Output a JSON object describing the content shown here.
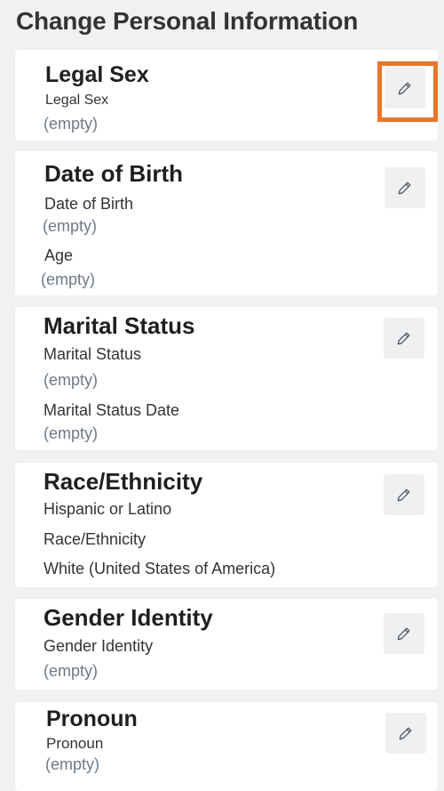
{
  "page": {
    "title": "Change Personal Information"
  },
  "highlight_color": "#e8762b",
  "sections": {
    "legal_sex": {
      "heading": "Legal Sex",
      "fields": [
        {
          "label": "Legal Sex",
          "value": "(empty)"
        }
      ],
      "edit_icon": "pencil-icon"
    },
    "date_of_birth": {
      "heading": "Date of Birth",
      "fields": [
        {
          "label": "Date of Birth",
          "value": "(empty)"
        },
        {
          "label": "Age",
          "value": "(empty)"
        }
      ],
      "edit_icon": "pencil-icon"
    },
    "marital_status": {
      "heading": "Marital Status",
      "fields": [
        {
          "label": "Marital Status",
          "value": "(empty)"
        },
        {
          "label": "Marital Status Date",
          "value": "(empty)"
        }
      ],
      "edit_icon": "pencil-icon"
    },
    "race_ethnicity": {
      "heading": "Race/Ethnicity",
      "fields": [
        {
          "label": "Hispanic or Latino"
        },
        {
          "label": "Race/Ethnicity",
          "value": "White (United States of America)"
        }
      ],
      "edit_icon": "pencil-icon"
    },
    "gender_identity": {
      "heading": "Gender Identity",
      "fields": [
        {
          "label": "Gender Identity",
          "value": "(empty)"
        }
      ],
      "edit_icon": "pencil-icon"
    },
    "pronoun": {
      "heading": "Pronoun",
      "fields": [
        {
          "label": "Pronoun",
          "value": "(empty)"
        }
      ],
      "edit_icon": "pencil-icon"
    }
  }
}
